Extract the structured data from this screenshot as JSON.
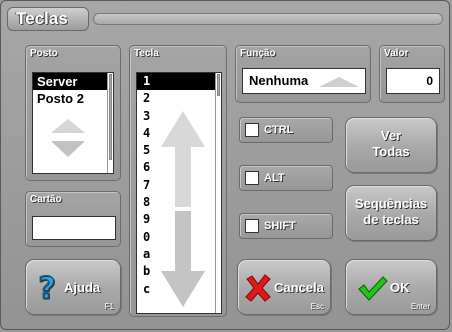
{
  "window": {
    "title": "Teclas"
  },
  "posto": {
    "label": "Posto",
    "items": [
      {
        "label": "Server",
        "selected": true
      },
      {
        "label": "Posto 2",
        "selected": false
      }
    ]
  },
  "cartao": {
    "label": "Cartão",
    "value": ""
  },
  "tecla": {
    "label": "Tecla",
    "items": [
      "1",
      "2",
      "3",
      "4",
      "5",
      "6",
      "7",
      "8",
      "9",
      "0",
      "a",
      "b",
      "c"
    ],
    "selected_index": 0
  },
  "funcao": {
    "label": "Função",
    "value": "Nenhuma"
  },
  "valor": {
    "label": "Valor",
    "value": "0"
  },
  "modifiers": {
    "ctrl": "CTRL",
    "alt": "ALT",
    "shift": "SHIFT"
  },
  "buttons": {
    "ver_todas_line1": "Ver",
    "ver_todas_line2": "Todas",
    "sequencias_line1": "Sequências",
    "sequencias_line2": "de teclas",
    "ajuda": "Ajuda",
    "ajuda_shortcut": "F1",
    "cancela": "Cancela",
    "cancela_shortcut": "Esc",
    "ok": "OK",
    "ok_shortcut": "Enter"
  },
  "colors": {
    "help_icon": "#2aa6e0",
    "cancel_icon": "#e01818",
    "ok_icon": "#22c418"
  },
  "icons": {
    "help": "question-mark-icon",
    "cancel": "x-mark-icon",
    "ok": "check-mark-icon"
  }
}
